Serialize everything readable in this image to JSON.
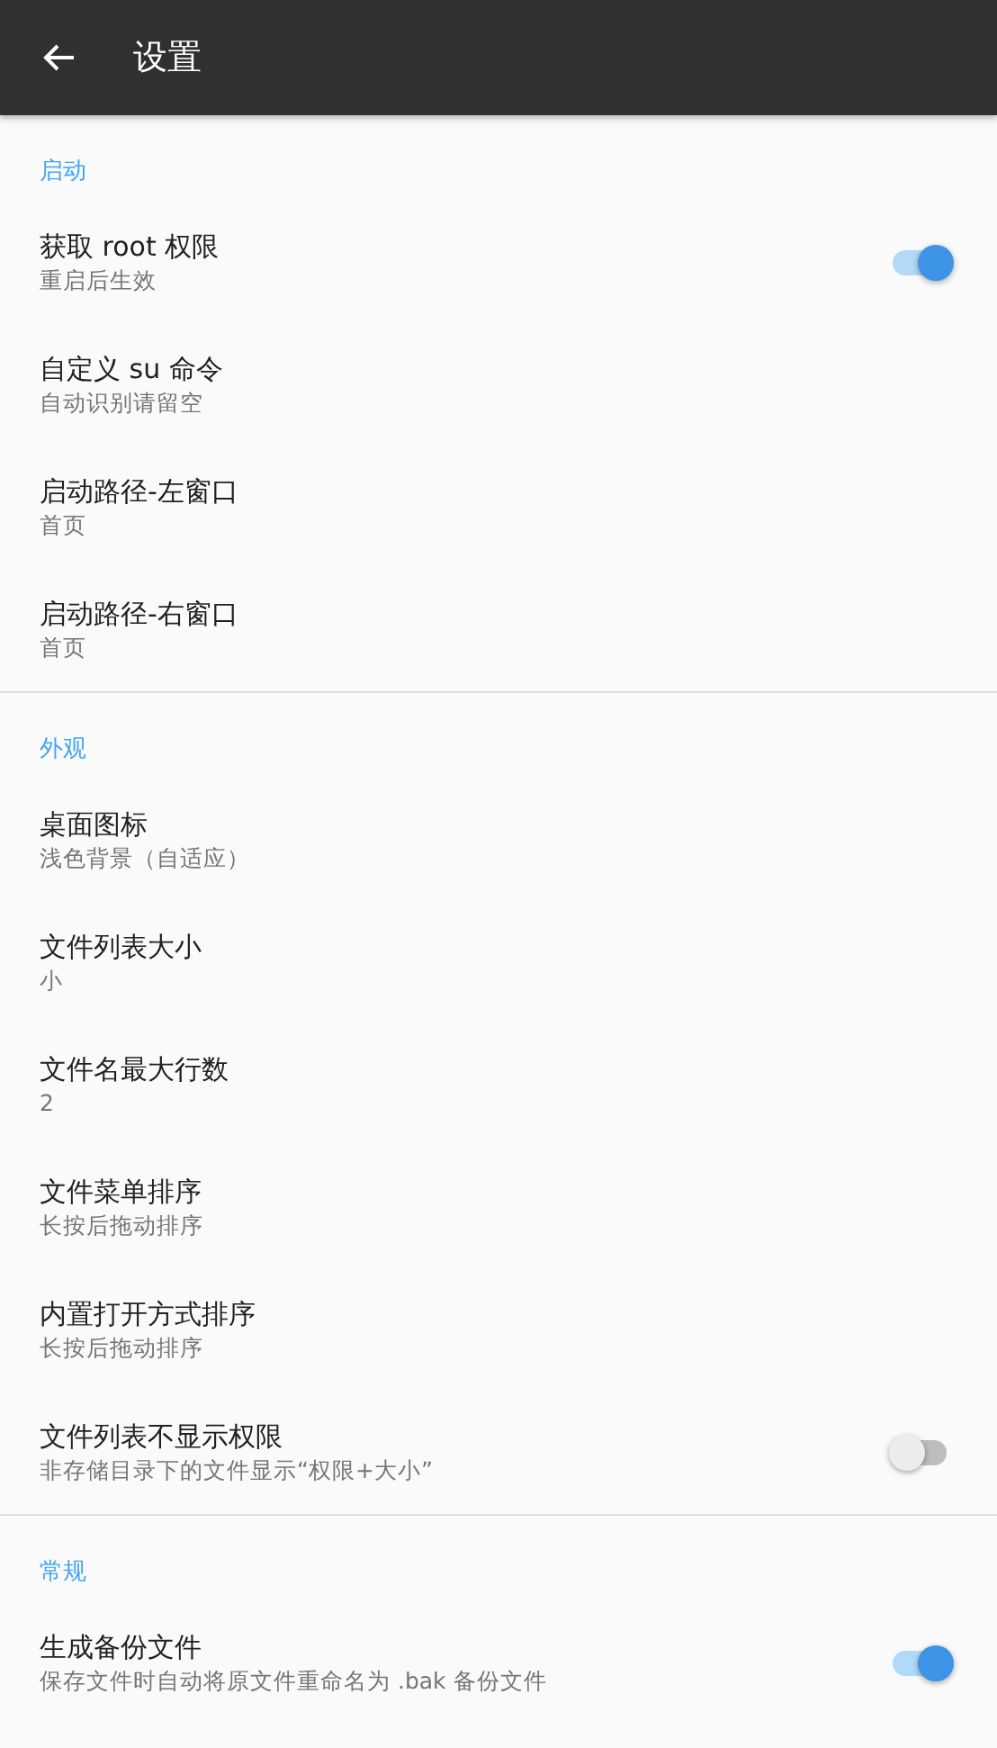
{
  "app_bar": {
    "title": "设置"
  },
  "sections": [
    {
      "header": "启动",
      "items": [
        {
          "kind": "switch",
          "title": "获取 root 权限",
          "summary": "重启后生效",
          "on": true
        },
        {
          "kind": "plain",
          "title": "自定义 su 命令",
          "summary": "自动识别请留空"
        },
        {
          "kind": "plain",
          "title": "启动路径-左窗口",
          "summary": "首页"
        },
        {
          "kind": "plain",
          "title": "启动路径-右窗口",
          "summary": "首页"
        }
      ]
    },
    {
      "header": "外观",
      "items": [
        {
          "kind": "plain",
          "title": "桌面图标",
          "summary": "浅色背景（自适应）"
        },
        {
          "kind": "plain",
          "title": "文件列表大小",
          "summary": "小"
        },
        {
          "kind": "plain",
          "title": "文件名最大行数",
          "summary": "2"
        },
        {
          "kind": "plain",
          "title": "文件菜单排序",
          "summary": "长按后拖动排序"
        },
        {
          "kind": "plain",
          "title": "内置打开方式排序",
          "summary": "长按后拖动排序"
        },
        {
          "kind": "switch",
          "title": "文件列表不显示权限",
          "summary": "非存储目录下的文件显示“权限+大小”",
          "on": false
        }
      ]
    },
    {
      "header": "常规",
      "items": [
        {
          "kind": "switch",
          "title": "生成备份文件",
          "summary": "保存文件时自动将原文件重命名为 .bak 备份文件",
          "on": true
        }
      ]
    }
  ]
}
